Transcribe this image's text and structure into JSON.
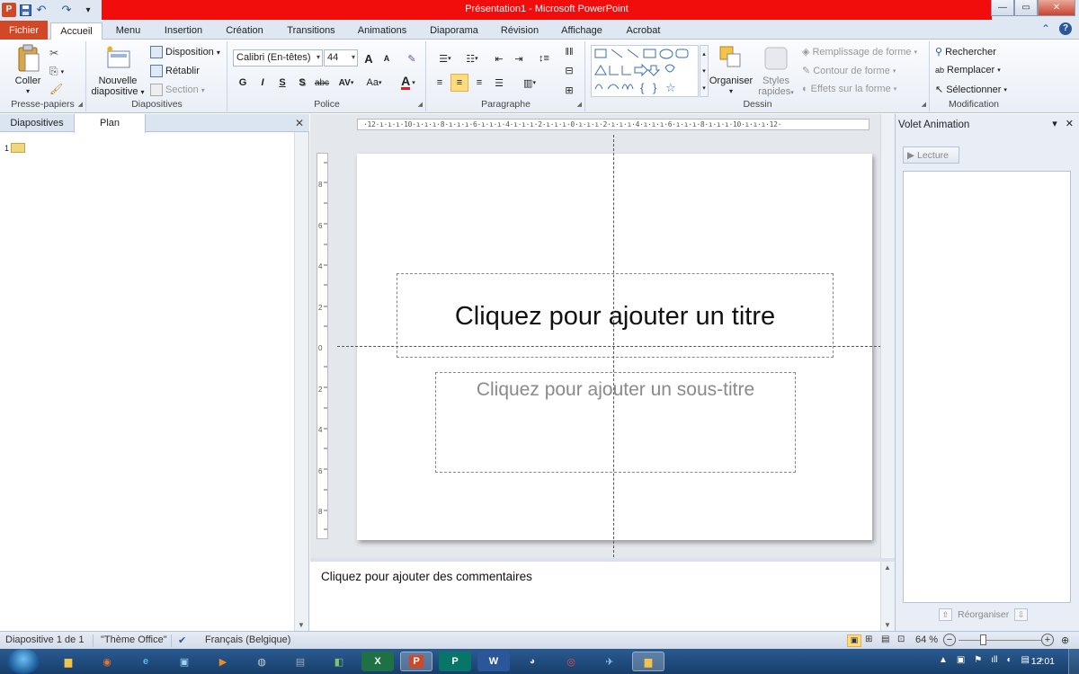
{
  "window": {
    "title": "Présentation1  -  Microsoft PowerPoint",
    "controls": {
      "minimize": "—",
      "maximize": "▭",
      "close": "✕"
    }
  },
  "qat": {
    "app_icon": "P",
    "undo": "↶",
    "redo": "↷",
    "customize": "▾"
  },
  "tabs": {
    "file": "Fichier",
    "items": [
      "Accueil",
      "Menu",
      "Insertion",
      "Création",
      "Transitions",
      "Animations",
      "Diaporama",
      "Révision",
      "Affichage",
      "Acrobat"
    ],
    "active": "Accueil",
    "collapse_icon": "⌃",
    "help_icon": "?"
  },
  "ribbon": {
    "clipboard": {
      "label": "Presse-papiers",
      "paste": "Coller"
    },
    "slides": {
      "label": "Diapositives",
      "new_slide_line1": "Nouvelle",
      "new_slide_line2": "diapositive",
      "layout": "Disposition",
      "reset": "Rétablir",
      "section": "Section"
    },
    "font": {
      "label": "Police",
      "font_name": "Calibri (En-têtes)",
      "font_size": "44",
      "bold": "G",
      "italic": "I",
      "underline": "S",
      "shadow": "S",
      "strike": "abc",
      "spacing": "AV",
      "case": "Aa",
      "color": "A",
      "grow": "A",
      "shrink": "A"
    },
    "paragraph": {
      "label": "Paragraphe"
    },
    "drawing": {
      "label": "Dessin",
      "arrange": "Organiser",
      "quick_styles_line1": "Styles",
      "quick_styles_line2": "rapides",
      "fill": "Remplissage de forme",
      "outline": "Contour de forme",
      "effects": "Effets sur la forme"
    },
    "editing": {
      "label": "Modification",
      "find": "Rechercher",
      "replace": "Remplacer",
      "select": "Sélectionner"
    }
  },
  "left_pane": {
    "tabs": [
      "Diapositives",
      "Plan"
    ],
    "active_tab": "Plan",
    "close": "✕",
    "slide_number": "1"
  },
  "slide": {
    "title_placeholder": "Cliquez pour ajouter un titre",
    "subtitle_placeholder": "Cliquez pour ajouter un sous-titre"
  },
  "rulers": {
    "horizontal": "·12·ı·ı·ı·10·ı·ı·ı·8·ı·ı·ı·6·ı·ı·ı·4·ı·ı·ı·2·ı·ı·ı·0·ı·ı·ı·2·ı·ı·ı·4·ı·ı·ı·6·ı·ı·ı·8·ı·ı·ı·10·ı·ı·ı·12·",
    "vertical_marks": [
      "8",
      "6",
      "4",
      "2",
      "0",
      "2",
      "4",
      "6",
      "8"
    ]
  },
  "notes": {
    "placeholder": "Cliquez pour ajouter des commentaires"
  },
  "animation_pane": {
    "title": "Volet Animation",
    "play": "Lecture",
    "reorder": "Réorganiser",
    "dropdown": "▾",
    "close": "✕"
  },
  "statusbar": {
    "slide_info": "Diapositive 1 de 1",
    "theme": "\"Thème Office\"",
    "language": "Français (Belgique)",
    "zoom": "64 %",
    "zoom_out": "−",
    "zoom_in": "+"
  },
  "taskbar": {
    "apps": [
      "explorer",
      "firefox",
      "ie",
      "app4",
      "vlc",
      "app6",
      "app7",
      "app8",
      "excel",
      "powerpoint",
      "publisher",
      "word",
      "gimp",
      "chrome",
      "app15",
      "app16"
    ],
    "active_app": "powerpoint",
    "clock": "12:01"
  },
  "colors": {
    "title_bar_red": "#f20d0d",
    "file_tab": "#d24726",
    "ribbon_bg": "#e9eef6",
    "selection": "#fddc80"
  }
}
